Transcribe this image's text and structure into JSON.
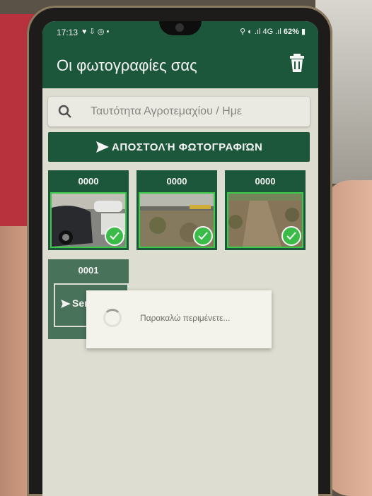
{
  "status_bar": {
    "time": "17:13",
    "left_icons": "♥ ⇩ ◎ •",
    "right_icons": "⚲ ◐ .ıl 4G .ıl",
    "battery": "62%"
  },
  "app_bar": {
    "title": "Οι φωτογραφίες σας",
    "trash_icon": "trash-icon"
  },
  "search": {
    "placeholder": "Ταυτότητα Αγροτεμαχίου / Ημε"
  },
  "send_button": {
    "label": "ΑΠΟΣΤΟΛΉ ΦΩΤΟΓΡΑΦΙΏΝ"
  },
  "photos": [
    {
      "code": "0000",
      "checked": true
    },
    {
      "code": "0000",
      "checked": true
    },
    {
      "code": "0000",
      "checked": true
    },
    {
      "code": "0001",
      "status": "Sent!"
    }
  ],
  "dialog": {
    "message": "Παρακαλώ περιμένετε..."
  },
  "colors": {
    "primary": "#1f5b3e",
    "check": "#3ec44c",
    "background": "#e8e6da"
  }
}
